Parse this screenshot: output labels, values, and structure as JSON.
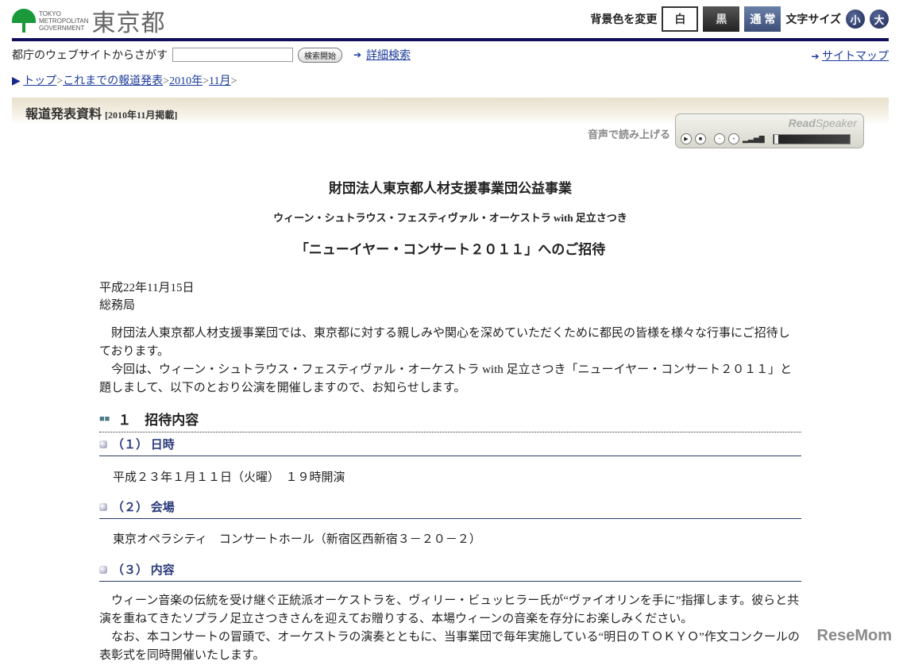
{
  "header": {
    "logo_en": [
      "TOKYO",
      "METROPOLITAN",
      "GOVERNMENT"
    ],
    "logo_jp": "東京都",
    "bg_label": "背景色を変更",
    "bg_white": "白",
    "bg_black": "黒",
    "bg_normal": "通 常",
    "font_label": "文字サイズ",
    "font_small": "小",
    "font_large": "大"
  },
  "search": {
    "label": "都庁のウェブサイトからさがす",
    "value": "",
    "button": "検索開始",
    "advanced": "詳細検索",
    "sitemap": "サイトマップ"
  },
  "breadcrumb": [
    {
      "label": "トップ"
    },
    {
      "label": "これまでの報道発表"
    },
    {
      "label": "2010年"
    },
    {
      "label": "11月"
    }
  ],
  "band": {
    "title": "報道発表資料",
    "date": "[2010年11月掲載]"
  },
  "readspeaker": {
    "label": "音声で読み上げる",
    "brand_bold": "Read",
    "brand": "Speaker"
  },
  "doc": {
    "title1": "財団法人東京都人材支援事業団公益事業",
    "title2": "ウィーン・シュトラウス・フェスティヴァル・オーケストラ with 足立さつき",
    "title3": "「ニューイヤー・コンサート２０１１」へのご招待",
    "date": "平成22年11月15日",
    "bureau": "総務局",
    "intro1": "財団法人東京都人材支援事業団では、東京都に対する親しみや関心を深めていただくために都民の皆様を様々な行事にご招待しております。",
    "intro2": "今回は、ウィーン・シュトラウス・フェスティヴァル・オーケストラ with 足立さつき「ニューイヤー・コンサート２０１１」と題しまして、以下のとおり公演を開催しますので、お知らせします。",
    "section1": "１　招待内容",
    "sub1": "（１） 日時",
    "sub1_text": "平成２３年１月１１日（火曜）　１９時開演",
    "sub2": "（２） 会場",
    "sub2_text": "東京オペラシティ　コンサートホール（新宿区西新宿３－２０－２）",
    "sub3": "（３） 内容",
    "sub3_p1": "ウィーン音楽の伝統を受け継ぐ正統派オーケストラを、ヴィリー・ビュッヒラー氏が“ヴァイオリンを手に”指揮します。彼らと共演を重ねてきたソプラノ足立さつきさんを迎えてお贈りする、本場ウィーンの音楽を存分にお楽しみください。",
    "sub3_p2": "なお、本コンサートの冒頭で、オーケストラの演奏とともに、当事業団で毎年実施している“明日のＴＯＫＹＯ”作文コンクールの表彰式を同時開催いたします。"
  },
  "watermark": "ReseMom"
}
